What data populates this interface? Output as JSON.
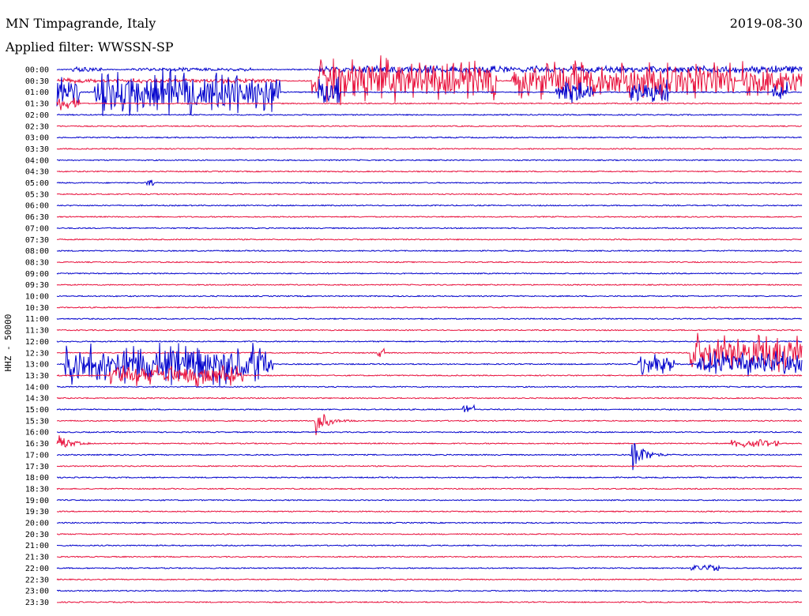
{
  "header": {
    "station": "MN Timpagrande, Italy",
    "date": "2019-08-30",
    "filter_label": "Applied filter: WWSSN-SP"
  },
  "channel": "HHZ - 50000",
  "colors": {
    "even_row": "#0000cc",
    "odd_row": "#e8103c",
    "text": "#000000"
  },
  "chart_data": {
    "type": "line",
    "subtype": "helicorder",
    "row_labels": [
      "00:00",
      "00:30",
      "01:00",
      "01:30",
      "02:00",
      "02:30",
      "03:00",
      "03:30",
      "04:00",
      "04:30",
      "05:00",
      "05:30",
      "06:00",
      "06:30",
      "07:00",
      "07:30",
      "08:00",
      "08:30",
      "09:00",
      "09:30",
      "10:00",
      "10:30",
      "11:00",
      "11:30",
      "12:00",
      "12:30",
      "13:00",
      "13:30",
      "14:00",
      "14:30",
      "15:00",
      "15:30",
      "16:00",
      "16:30",
      "17:00",
      "17:30",
      "18:00",
      "18:30",
      "19:00",
      "19:30",
      "20:00",
      "20:30",
      "21:00",
      "21:30",
      "22:00",
      "22:30",
      "23:00",
      "23:30"
    ],
    "row_minutes": 30,
    "trace_colors": [
      "#0000cc",
      "#e8103c"
    ],
    "bursts": [
      {
        "row": 0,
        "start": 0.02,
        "end": 0.06,
        "amp": 0.25,
        "style": "noise"
      },
      {
        "row": 0,
        "start": 0.1,
        "end": 0.26,
        "amp": 0.15,
        "style": "noise"
      },
      {
        "row": 0,
        "start": 0.35,
        "end": 1.0,
        "amp": 0.35,
        "style": "noise"
      },
      {
        "row": 1,
        "start": 0.0,
        "end": 0.3,
        "amp": 0.2,
        "style": "noise"
      },
      {
        "row": 1,
        "start": 0.34,
        "end": 0.59,
        "amp": 2.3,
        "style": "swarm"
      },
      {
        "row": 1,
        "start": 0.61,
        "end": 0.91,
        "amp": 1.8,
        "style": "swarm"
      },
      {
        "row": 1,
        "start": 0.92,
        "end": 1.0,
        "amp": 1.8,
        "style": "swarm"
      },
      {
        "row": 2,
        "start": 0.0,
        "end": 0.03,
        "amp": 1.6,
        "style": "swarm"
      },
      {
        "row": 2,
        "start": 0.05,
        "end": 0.3,
        "amp": 2.2,
        "style": "swarm"
      },
      {
        "row": 2,
        "start": 0.35,
        "end": 0.38,
        "amp": 1.8,
        "style": "swarm"
      },
      {
        "row": 2,
        "start": 0.67,
        "end": 0.72,
        "amp": 1.2,
        "style": "swarm"
      },
      {
        "row": 2,
        "start": 0.77,
        "end": 0.82,
        "amp": 1.2,
        "style": "swarm"
      },
      {
        "row": 2,
        "start": 0.96,
        "end": 0.98,
        "amp": 1.0,
        "style": "swarm"
      },
      {
        "row": 3,
        "start": 0.0,
        "end": 0.03,
        "amp": 0.6,
        "style": "swarm"
      },
      {
        "row": 10,
        "start": 0.12,
        "end": 0.13,
        "amp": 0.4,
        "style": "noise"
      },
      {
        "row": 25,
        "start": 0.43,
        "end": 0.44,
        "amp": 0.4,
        "style": "noise"
      },
      {
        "row": 25,
        "start": 0.85,
        "end": 1.0,
        "amp": 1.8,
        "style": "swarm"
      },
      {
        "row": 26,
        "start": 0.01,
        "end": 0.28,
        "amp": 2.0,
        "style": "swarm"
      },
      {
        "row": 26,
        "start": 0.26,
        "end": 0.29,
        "amp": 1.0,
        "style": "swarm"
      },
      {
        "row": 26,
        "start": 0.78,
        "end": 0.83,
        "amp": 0.9,
        "style": "swarm"
      },
      {
        "row": 26,
        "start": 0.86,
        "end": 1.0,
        "amp": 1.2,
        "style": "swarm"
      },
      {
        "row": 27,
        "start": 0.07,
        "end": 0.25,
        "amp": 1.0,
        "style": "swarm"
      },
      {
        "row": 30,
        "start": 0.545,
        "end": 0.56,
        "amp": 0.4,
        "style": "noise"
      },
      {
        "row": 31,
        "start": 0.345,
        "end": 0.4,
        "amp": 1.3,
        "style": "quake"
      },
      {
        "row": 33,
        "start": 0.0,
        "end": 0.06,
        "amp": 0.8,
        "style": "quake"
      },
      {
        "row": 33,
        "start": 0.905,
        "end": 0.97,
        "amp": 0.35,
        "style": "noise"
      },
      {
        "row": 34,
        "start": 0.77,
        "end": 0.83,
        "amp": 1.5,
        "style": "quake"
      },
      {
        "row": 44,
        "start": 0.85,
        "end": 0.89,
        "amp": 0.35,
        "style": "noise"
      }
    ]
  }
}
